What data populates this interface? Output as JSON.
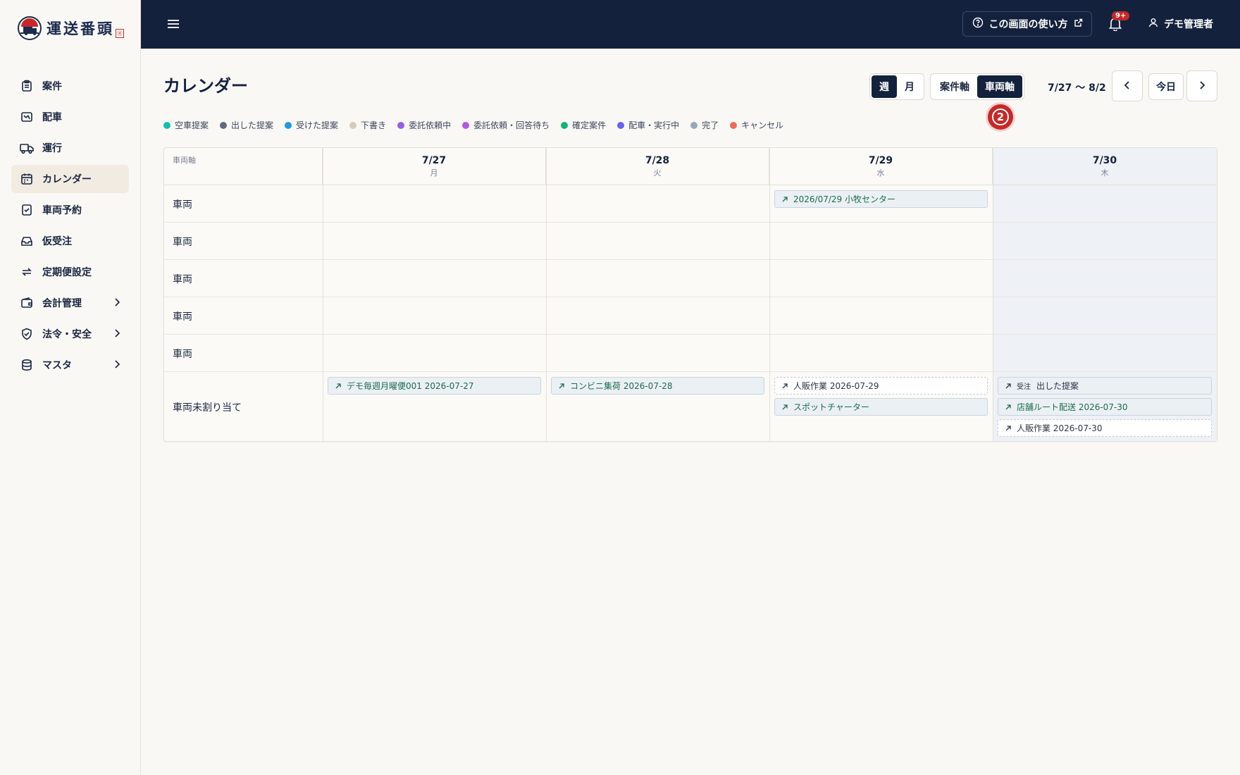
{
  "app": {
    "logo_text": "運送番頭",
    "logo_seal": "Ⓡ"
  },
  "sidebar": {
    "items": [
      {
        "label": "案件",
        "icon": "clipboard-icon",
        "active": false,
        "chevron": false
      },
      {
        "label": "配車",
        "icon": "chart-truck-icon",
        "active": false,
        "chevron": false
      },
      {
        "label": "運行",
        "icon": "truck-icon",
        "active": false,
        "chevron": false
      },
      {
        "label": "カレンダー",
        "icon": "calendar-icon",
        "active": true,
        "chevron": false
      },
      {
        "label": "車両予約",
        "icon": "checklist-icon",
        "active": false,
        "chevron": false
      },
      {
        "label": "仮受注",
        "icon": "inbox-icon",
        "active": false,
        "chevron": false
      },
      {
        "label": "定期便設定",
        "icon": "repeat-icon",
        "active": false,
        "chevron": false
      },
      {
        "label": "会計管理",
        "icon": "wallet-icon",
        "active": false,
        "chevron": true
      },
      {
        "label": "法令・安全",
        "icon": "shield-icon",
        "active": false,
        "chevron": true
      },
      {
        "label": "マスタ",
        "icon": "database-icon",
        "active": false,
        "chevron": true
      }
    ]
  },
  "header": {
    "help_label": "この画面の使い方",
    "notif_badge": "9+",
    "user_name": "デモ管理者"
  },
  "page": {
    "title": "カレンダー",
    "view_toggle": {
      "week": "週",
      "month": "月"
    },
    "axis_toggle": {
      "case": "案件軸",
      "vehicle": "車両軸"
    },
    "range": "7/27 〜 8/2",
    "today": "今日",
    "step_marker": "2"
  },
  "legend": [
    {
      "label": "空車提案",
      "color": "#14c0b0"
    },
    {
      "label": "出した提案",
      "color": "#5f6b7d"
    },
    {
      "label": "受けた提案",
      "color": "#1e9be0"
    },
    {
      "label": "下書き",
      "color": "#d5cbbb"
    },
    {
      "label": "委託依頼中",
      "color": "#9b5de5"
    },
    {
      "label": "委託依頼・回答待ち",
      "color": "#b05ae0"
    },
    {
      "label": "確定案件",
      "color": "#16b07a"
    },
    {
      "label": "配車・実行中",
      "color": "#6366f1"
    },
    {
      "label": "完了",
      "color": "#9aa6ba"
    },
    {
      "label": "キャンセル",
      "color": "#ef6b5b"
    }
  ],
  "calendar": {
    "axis_label": "車両軸",
    "days": [
      {
        "date": "7/27",
        "weekday": "月"
      },
      {
        "date": "7/28",
        "weekday": "火"
      },
      {
        "date": "7/29",
        "weekday": "水"
      },
      {
        "date": "7/30",
        "weekday": "木"
      }
    ],
    "rows": [
      "車両",
      "車両",
      "車両",
      "車両",
      "車両",
      "車両未割り当て"
    ],
    "events": [
      {
        "label": "2026/07/29 小牧センター",
        "style": "solid"
      },
      {
        "label": "デモ毎週月曜便001 2026-07-27",
        "style": "solid"
      },
      {
        "label": "コンビニ集荷 2026-07-28",
        "style": "solid"
      },
      {
        "label": "人販作業 2026-07-29",
        "style": "dash"
      },
      {
        "label": "スポットチャーター",
        "style": "solid"
      },
      {
        "label": "出した提案",
        "tag": "受注",
        "style": "solid"
      },
      {
        "label": "店舗ルート配送 2026-07-30",
        "style": "solid"
      },
      {
        "label": "人販作業 2026-07-30",
        "style": "dash"
      }
    ]
  }
}
